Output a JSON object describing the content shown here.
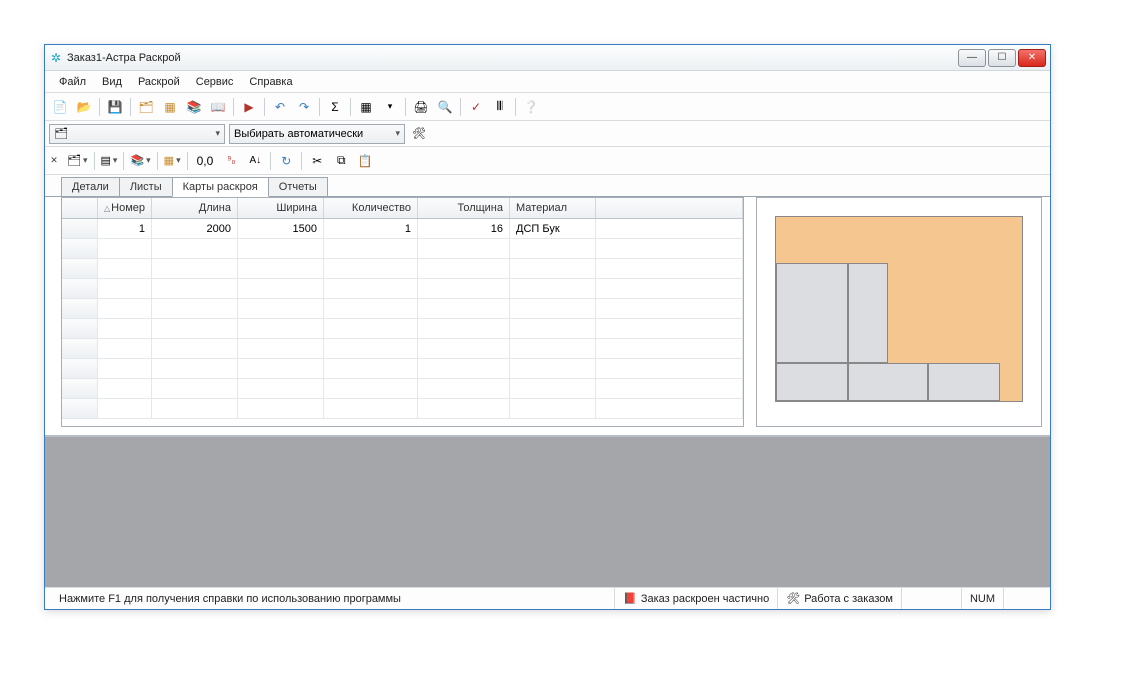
{
  "window": {
    "title": "Заказ1-Астра Раскрой"
  },
  "menu": {
    "file": "Файл",
    "view": "Вид",
    "raskroy": "Раскрой",
    "service": "Сервис",
    "help": "Справка"
  },
  "selectbar": {
    "auto": "Выбирать автоматически"
  },
  "toolbar2": {
    "mode_00": "0,0"
  },
  "tabs": {
    "details": "Детали",
    "sheets": "Листы",
    "maps": "Карты раскроя",
    "reports": "Отчеты"
  },
  "grid": {
    "headers": {
      "num": "Номер",
      "len": "Длина",
      "wid": "Ширина",
      "qty": "Количество",
      "thick": "Толщина",
      "mat": "Материал"
    },
    "rows": [
      {
        "num": "1",
        "len": "2000",
        "wid": "1500",
        "qty": "1",
        "thick": "16",
        "mat": "ДСП Бук"
      }
    ]
  },
  "status": {
    "help": "Нажмите F1 для получения справки по использованию программы",
    "partial": "Заказ раскроен частично",
    "work": "Работа с заказом",
    "num": "NUM"
  }
}
